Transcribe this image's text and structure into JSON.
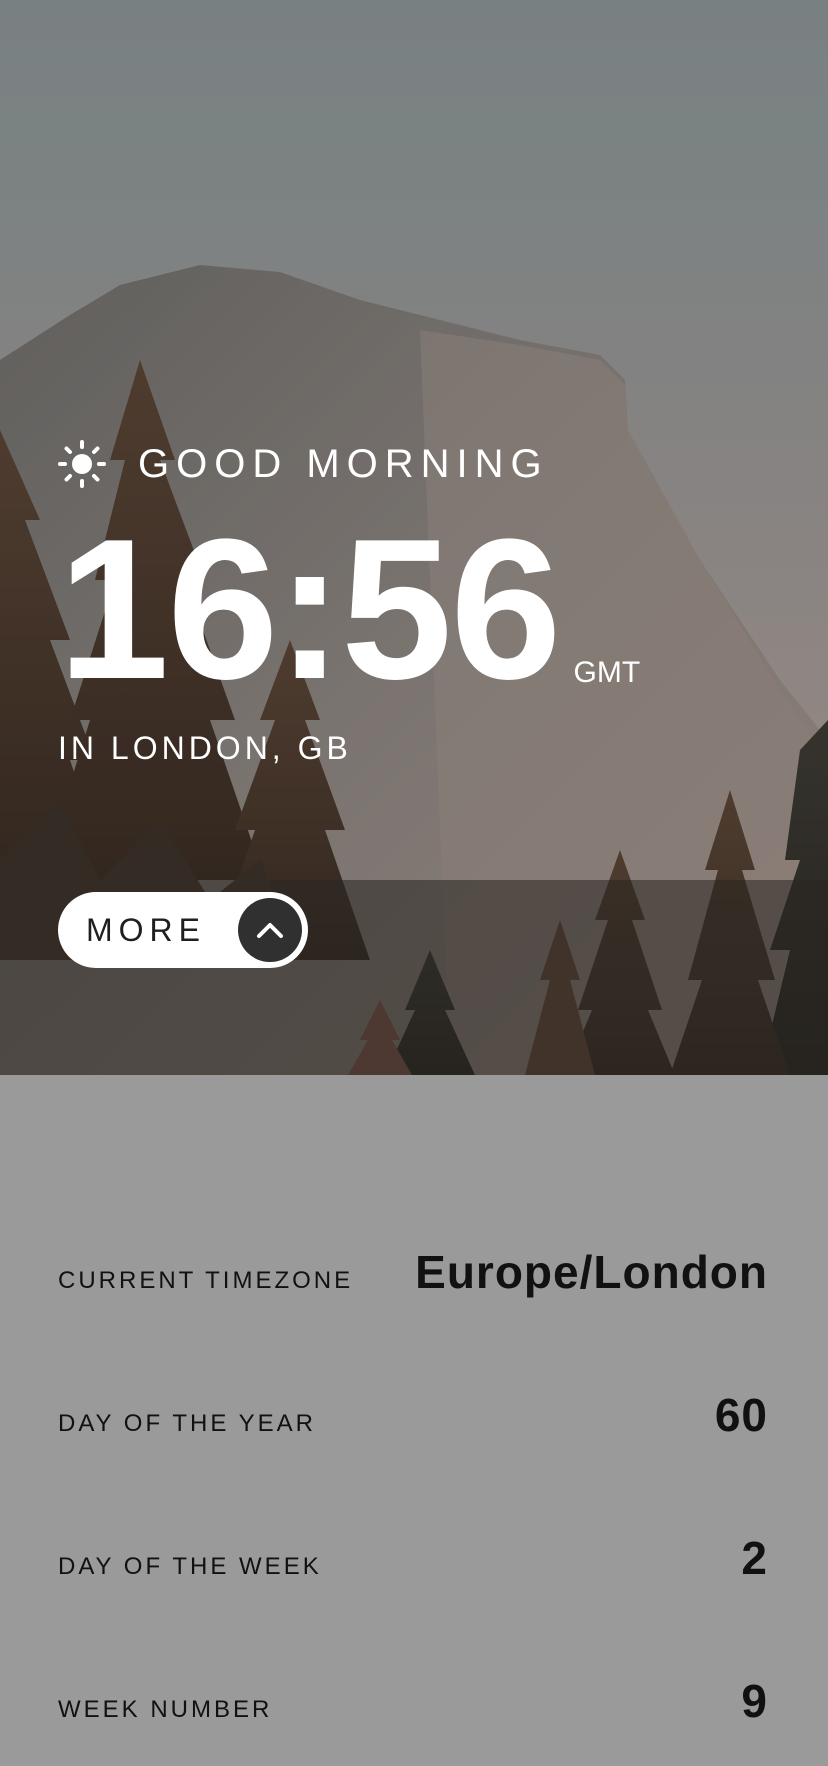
{
  "header": {
    "greeting": "GOOD MORNING",
    "time": "16:56",
    "timezone_abbr": "GMT",
    "location": "IN LONDON, GB",
    "greeting_icon": "sun-icon"
  },
  "more_button": {
    "label": "MORE",
    "icon": "chevron-up-icon"
  },
  "details": {
    "rows": [
      {
        "label": "CURRENT TIMEZONE",
        "value": "Europe/London"
      },
      {
        "label": "DAY OF THE YEAR",
        "value": "60"
      },
      {
        "label": "DAY OF THE WEEK",
        "value": "2"
      },
      {
        "label": "WEEK NUMBER",
        "value": "9"
      }
    ]
  },
  "colors": {
    "panel_background": "#9a9a9a",
    "button_background": "#ffffff",
    "button_icon_circle": "#303030",
    "hero_text": "#ffffff",
    "details_text": "#111111"
  }
}
